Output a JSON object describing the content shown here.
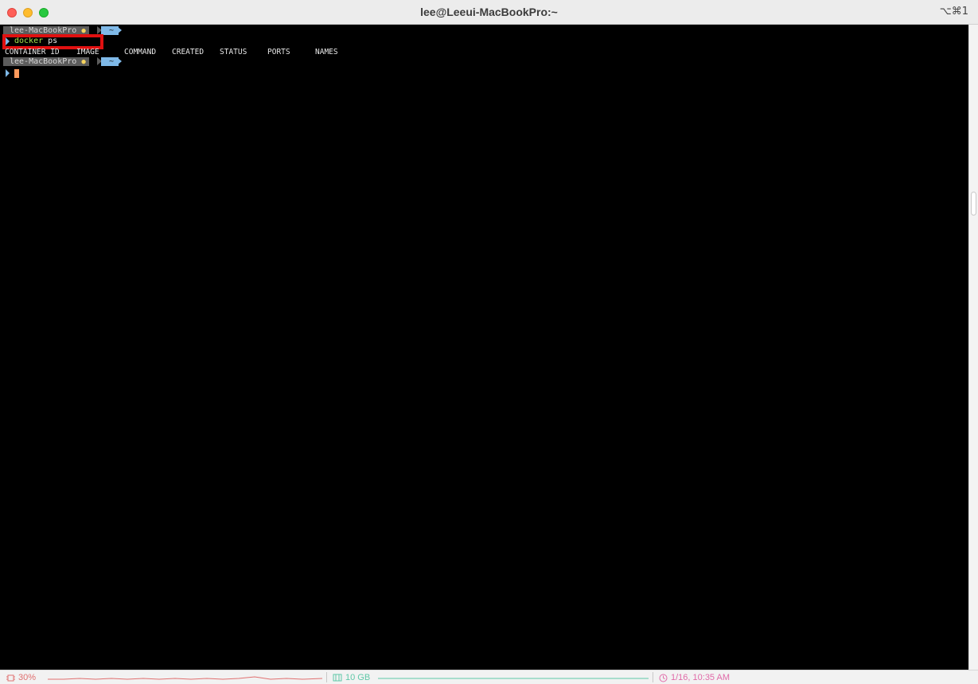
{
  "window": {
    "title": "lee@Leeui-MacBookPro:~",
    "shortcut": "⌥⌘1"
  },
  "terminal": {
    "prompt1": {
      "host": "lee-MacBookPro",
      "dir": "~"
    },
    "command": {
      "word": "docker",
      "args": " ps"
    },
    "columns": [
      "CONTAINER ID",
      "IMAGE",
      "COMMAND",
      "CREATED",
      "STATUS",
      "PORTS",
      "NAMES"
    ],
    "prompt2": {
      "host": "lee-MacBookPro",
      "dir": "~"
    }
  },
  "statusbar": {
    "cpu": "30%",
    "memory": "10 GB",
    "clock": "1/16, 10:35 AM"
  },
  "colors": {
    "highlight": "#e01010",
    "cmd": "#a6e34a",
    "cursor": "#ff9a5c",
    "prompt_dir": "#7fb9e8"
  }
}
